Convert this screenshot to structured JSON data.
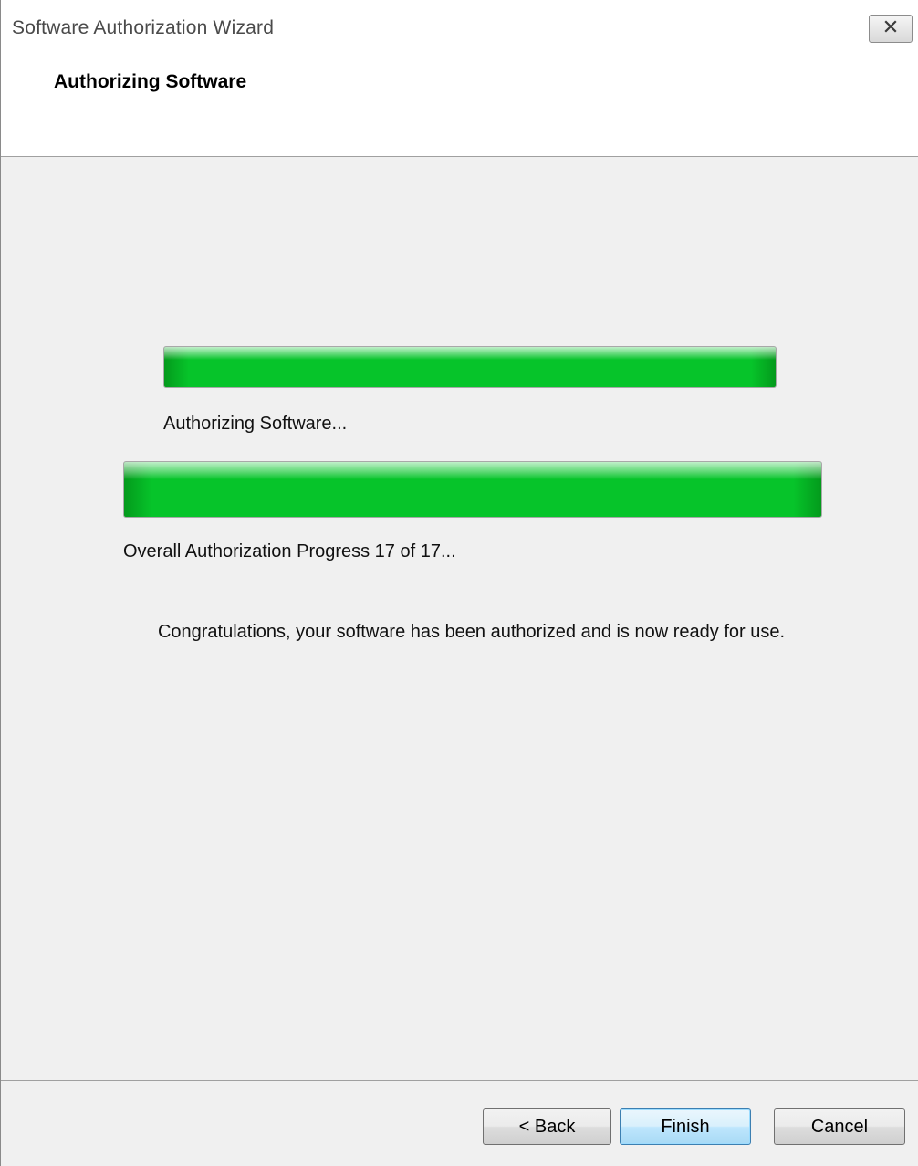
{
  "window": {
    "title": "Software Authorization Wizard",
    "close_icon": "close-icon"
  },
  "header": {
    "title": "Authorizing Software"
  },
  "main": {
    "step_progress": {
      "label": "Authorizing Software...",
      "percent": 100
    },
    "overall_progress": {
      "label": "Overall Authorization Progress 17 of 17...",
      "current": 17,
      "total": 17,
      "percent": 100
    },
    "message": "Congratulations, your software has been authorized and is now ready for use.",
    "progress_color": "#06c42a"
  },
  "footer": {
    "back_label": "< Back",
    "finish_label": "Finish",
    "cancel_label": "Cancel"
  }
}
